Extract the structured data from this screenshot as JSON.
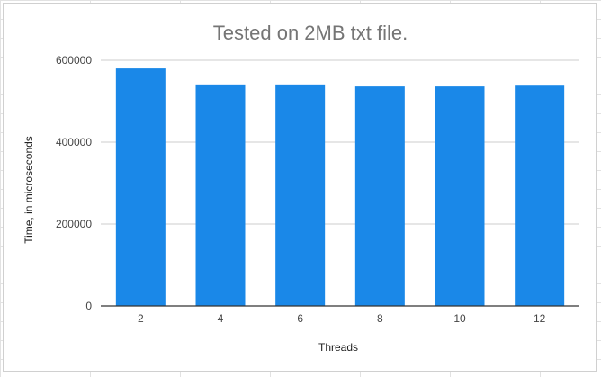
{
  "chart_data": {
    "type": "bar",
    "title": "Tested on 2MB txt file.",
    "xlabel": "Threads",
    "ylabel": "Time, in microseconds",
    "categories": [
      "2",
      "4",
      "6",
      "8",
      "10",
      "12"
    ],
    "values": [
      580000,
      541000,
      541000,
      536000,
      536000,
      538000
    ],
    "ylim": [
      0,
      600000
    ],
    "yticks": [
      "0",
      "200000",
      "400000",
      "600000"
    ],
    "grid": true,
    "bar_color": "#1a88e8"
  }
}
